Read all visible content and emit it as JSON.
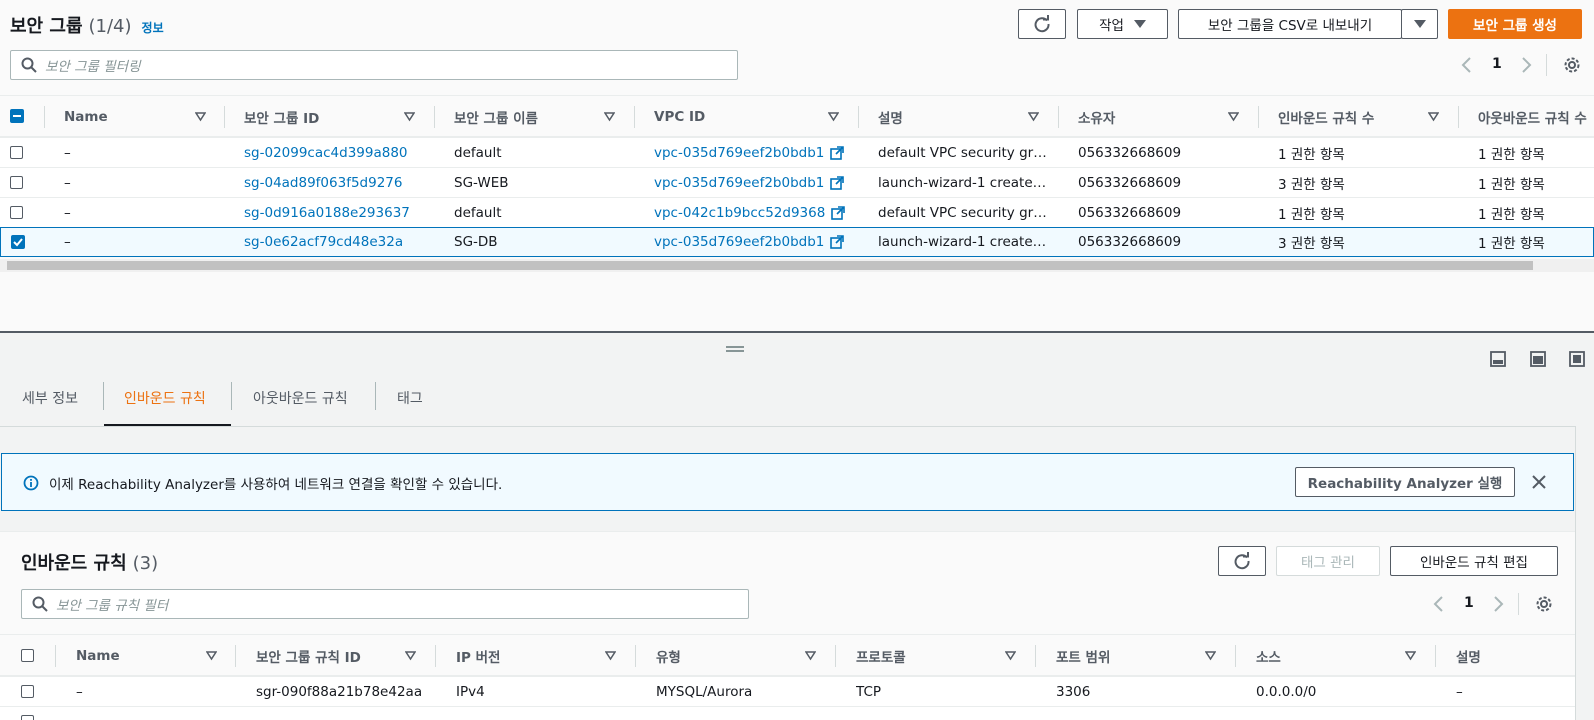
{
  "top": {
    "title": "보안 그룹",
    "count": "(1/4)",
    "info": "정보",
    "actions_label": "작업",
    "export_label": "보안 그룹을 CSV로 내보내기",
    "create_label": "보안 그룹 생성",
    "search_placeholder": "보안 그룹 필터링",
    "page": "1"
  },
  "sg_table": {
    "columns": [
      "Name",
      "보안 그룹 ID",
      "보안 그룹 이름",
      "VPC ID",
      "설명",
      "소유자",
      "인바운드 규칙 수",
      "아웃바운드 규칙 수"
    ],
    "rows": [
      {
        "name": "–",
        "id": "sg-02099cac4d399a880",
        "group_name": "default",
        "vpc": "vpc-035d769eef2b0bdb1",
        "desc": "default VPC security gr…",
        "owner": "056332668609",
        "inbound": "1 권한 항목",
        "outbound": "1 권한 항목",
        "selected": false
      },
      {
        "name": "–",
        "id": "sg-04ad89f063f5d9276",
        "group_name": "SG-WEB",
        "vpc": "vpc-035d769eef2b0bdb1",
        "desc": "launch-wizard-1 create…",
        "owner": "056332668609",
        "inbound": "3 권한 항목",
        "outbound": "1 권한 항목",
        "selected": false
      },
      {
        "name": "–",
        "id": "sg-0d916a0188e293637",
        "group_name": "default",
        "vpc": "vpc-042c1b9bcc52d9368",
        "desc": "default VPC security gr…",
        "owner": "056332668609",
        "inbound": "1 권한 항목",
        "outbound": "1 권한 항목",
        "selected": false
      },
      {
        "name": "–",
        "id": "sg-0e62acf79cd48e32a",
        "group_name": "SG-DB",
        "vpc": "vpc-035d769eef2b0bdb1",
        "desc": "launch-wizard-1 create…",
        "owner": "056332668609",
        "inbound": "3 권한 항목",
        "outbound": "1 권한 항목",
        "selected": true
      }
    ]
  },
  "tabs": [
    "세부 정보",
    "인바운드 규칙",
    "아웃바운드 규칙",
    "태그"
  ],
  "active_tab": "인바운드 규칙",
  "banner": {
    "text": "이제 Reachability Analyzer를 사용하여 네트워크 연결을 확인할 수 있습니다.",
    "button": "Reachability Analyzer 실행"
  },
  "inbound": {
    "title": "인바운드 규칙",
    "count": "(3)",
    "tag_manage": "태그 관리",
    "edit": "인바운드 규칙 편집",
    "search_placeholder": "보안 그룹 규칙 필터",
    "page": "1",
    "columns": [
      "Name",
      "보안 그룹 규칙 ID",
      "IP 버전",
      "유형",
      "프로토콜",
      "포트 범위",
      "소스",
      "설명"
    ],
    "rows": [
      {
        "name": "–",
        "id": "sgr-090f88a21b78e42aa",
        "ipver": "IPv4",
        "type": "MYSQL/Aurora",
        "proto": "TCP",
        "port": "3306",
        "source": "0.0.0.0/0",
        "desc": "–"
      }
    ]
  },
  "colors": {
    "accent": "#ec7211",
    "link": "#0073bb",
    "text": "#16191f",
    "muted": "#545b64"
  }
}
